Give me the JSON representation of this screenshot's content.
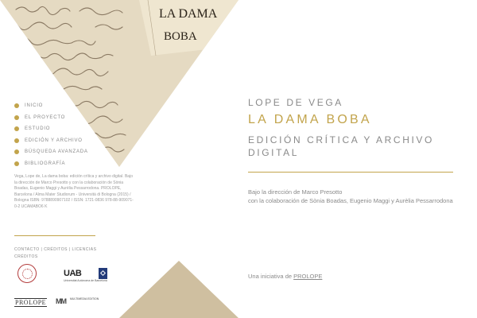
{
  "book_cover": {
    "line1": "LA DAMA",
    "line2": "BOBA"
  },
  "nav": {
    "items": [
      {
        "label": "INICIO"
      },
      {
        "label": "EL PROYECTO"
      },
      {
        "label": "ESTUDIO"
      },
      {
        "label": "EDICIÓN Y ARCHIVO"
      },
      {
        "label": "BÚSQUEDA AVANZADA"
      },
      {
        "label": "BIBLIOGRAFÍA"
      }
    ]
  },
  "credits": {
    "text": "Vega, Lope de, La dama boba: edición crítica y archivo digital. Bajo la dirección de Marco Presotto y con la colaboración de Sònia Boadas, Eugenio Maggi y Aurèlia Pessarrodona. PROLOPE, Barcelona / Alma Mater Studiorum - Università di Bologna (2015) / Bologna ISBN: 9788890907102 / ISSN: 1721-0836 978-88-909071-0-2 UCAMABO6 K"
  },
  "footer": {
    "link1": "CONTACTO",
    "link2": "CRÉDITOS",
    "link3": "LICENCIAS",
    "sep": "|",
    "second": "CRÉDITOS"
  },
  "logos": {
    "uab": "UAB",
    "uab_sub": "Universitat Autònoma de Barcelona",
    "prolope": "PROLOPE",
    "mm": "MM",
    "mm_text": "MULTIMEDIA EDITION"
  },
  "main": {
    "author": "LOPE DE VEGA",
    "title": "LA DAMA BOBA",
    "subtitle": "EDICIÓN CRÍTICA Y ARCHIVO DIGITAL",
    "direction_line1": "Bajo la dirección de Marco Presotto",
    "direction_line2": "con la colaboración de Sònia Boadas, Eugenio Maggi y Aurèlia Pessarrodona",
    "initiative_prefix": "Una iniciativa de ",
    "initiative_link": "PROLOPE"
  },
  "colors": {
    "gold": "#c2a44c",
    "parchment": "#e8dcc0",
    "bottom_triangle": "#cfbfa0"
  }
}
